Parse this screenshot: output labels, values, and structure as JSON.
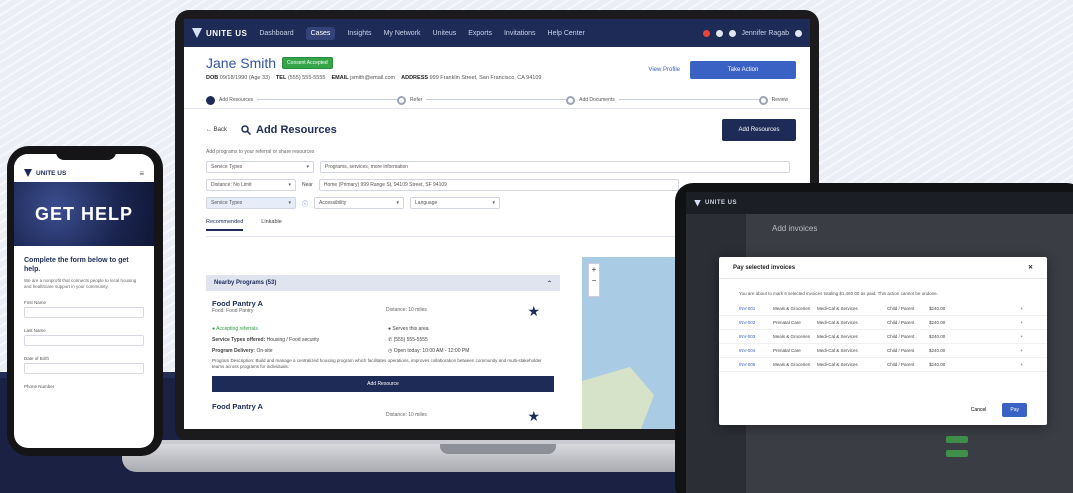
{
  "laptop": {
    "nav": {
      "logo": "UNITE US",
      "items": [
        "Dashboard",
        "Cases",
        "Insights",
        "My Network",
        "Uniteus",
        "Exports",
        "Invitations",
        "Help Center"
      ],
      "active_index": 1,
      "user": "Jennifer Ragab"
    },
    "profile": {
      "name": "Jane Smith",
      "badge": "Consent Accepted",
      "dob_label": "DOB",
      "dob": "09/18/1990 (Age 33)",
      "phone_label": "TEL",
      "phone": "(555) 555-5555",
      "email_label": "EMAIL",
      "email": "jsmith@email.com",
      "address_label": "ADDRESS",
      "address": "999 Franklin Street, San Francisco, CA 94109",
      "link": "View Profile",
      "button": "Take Action"
    },
    "steps": [
      "Add Resources",
      "Refer",
      "Add Documents",
      "Review"
    ],
    "resources": {
      "back": "← Back",
      "title": "Add Resources",
      "add_button": "Add Resources",
      "hint": "Add programs to your referral or share resources",
      "filters": [
        "Service Types",
        "Distance: No Limit",
        "Accessibility",
        "Language"
      ],
      "search_placeholder": "Programs, services, more information",
      "near_label": "Near",
      "near_value": "Home (Primary) 999 Range St, 94109 Street, SF 94109",
      "tabs": [
        "Recommended",
        "Linkable"
      ]
    },
    "list": {
      "header": "Nearby Programs (53)",
      "card": {
        "title": "Food Pantry A",
        "sub": "Food: Food Pantry",
        "distance": "Distance: 10 miles",
        "accepting": "Accepting referrals",
        "accepting_right": "Serves this area",
        "services_label": "Service Types offered:",
        "services_value": "Housing / Food security",
        "phone": "(555) 555-5555",
        "delivery_label": "Program Delivery:",
        "delivery_value": "On-site",
        "open": "Open today: 10:00 AM - 12:00 PM",
        "desc": "Program Description: Build and manage a centralized housing program which facilitates operations, improves collaboration between community and multi-stakeholder teams across programs for individuals."
      },
      "action": "Add Resource",
      "card2_title": "Food Pantry A",
      "card2_distance": "Distance: 10 miles"
    },
    "map": {
      "zoom_in": "+",
      "zoom_out": "−"
    }
  },
  "phone": {
    "logo": "UNITE US",
    "menu": "≡",
    "hero": "GET HELP",
    "form_title": "Complete the form below to get help.",
    "form_text": "We are a nonprofit that connects people to local housing and healthcare support in your community.",
    "fields": [
      "First Name",
      "Last Name",
      "Date of Birth",
      "Phone Number"
    ]
  },
  "tablet": {
    "logo": "UNITE US",
    "bg_title": "Add invoices",
    "modal": {
      "title": "Pay selected invoices",
      "close": "✕",
      "text": "You are about to mark 6 selected invoices totaling $1,460.00 as paid. This action cannot be undone.",
      "rows": [
        [
          "INV-001",
          "Meals & Groceries",
          "Medi-Cal & Services",
          "Child / Parent",
          "$240.00",
          "+"
        ],
        [
          "INV-002",
          "Prenatal Care",
          "Medi-Cal & Services",
          "Child / Parent",
          "$240.00",
          "+"
        ],
        [
          "INV-003",
          "Meals & Groceries",
          "Medi-Cal & Services",
          "Child / Parent",
          "$240.00",
          "+"
        ],
        [
          "INV-004",
          "Prenatal Care",
          "Medi-Cal & Services",
          "Child / Parent",
          "$240.00",
          "+"
        ],
        [
          "INV-005",
          "Meals & Groceries",
          "Medi-Cal & Services",
          "Child / Parent",
          "$240.00",
          "+"
        ]
      ],
      "cancel": "Cancel",
      "confirm": "Pay"
    }
  },
  "colors": {
    "navy": "#1e2b57",
    "blue": "#3a62c5",
    "green": "#35a54a",
    "footer_bg": "#1a2142"
  }
}
